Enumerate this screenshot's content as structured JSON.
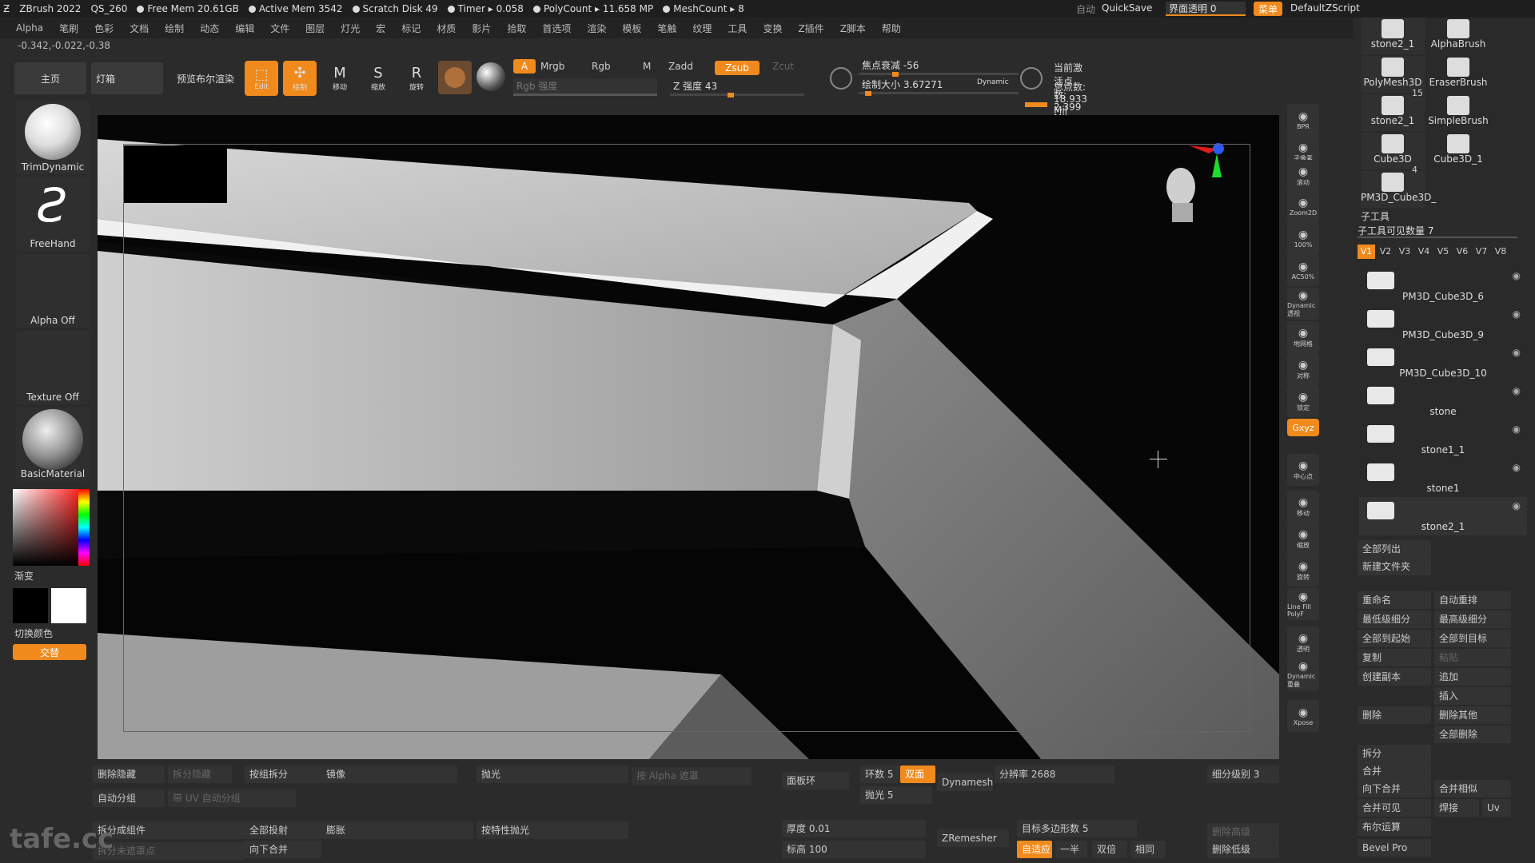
{
  "titlebar": {
    "app": "ZBrush 2022",
    "doc": "QS_260",
    "stats": [
      "Free Mem 20.61GB",
      "Active Mem 3542",
      "Scratch Disk 49",
      "Timer ▸ 0.058",
      "PolyCount ▸ 11.658 MP",
      "MeshCount ▸ 8"
    ],
    "auto": "自动",
    "quicksave": "QuickSave",
    "transparency": "界面透明 0",
    "menu_btn": "菜单",
    "script": "DefaultZScript"
  },
  "menubar": [
    "Alpha",
    "笔刷",
    "色彩",
    "文档",
    "绘制",
    "动态",
    "编辑",
    "文件",
    "图层",
    "灯光",
    "宏",
    "标记",
    "材质",
    "影片",
    "拾取",
    "首选项",
    "渲染",
    "模板",
    "笔触",
    "纹理",
    "工具",
    "变换",
    "Z插件",
    "Z脚本",
    "帮助"
  ],
  "coords": "-0.342,-0.022,-0.38",
  "toolbar": {
    "home": "主页",
    "lightbox": "灯箱",
    "bpr": "预览布尔渲染",
    "edit": "Edit",
    "draw": "绘制",
    "move": "移动",
    "scale": "缩放",
    "rotate": "旋转",
    "a": "A",
    "mrgb": "Mrgb",
    "rgb": "Rgb",
    "m": "M",
    "rgb_intensity": "Rgb 强度",
    "zadd": "Zadd",
    "zsub": "Zsub",
    "zcut": "Zcut",
    "z_intensity": "Z 强度 43",
    "z_intensity_value": 43,
    "focal_shift": "焦点衰减 -56",
    "draw_size": "绘制大小 3.67271",
    "dynamic": "Dynamic",
    "active_points": "当前激活点数: 2.399 Mil",
    "total_points": "总点数: 18.933 Mil"
  },
  "leftpanel": {
    "brush1": "TrimDynamic",
    "brush2": "FreeHand",
    "alpha": "Alpha Off",
    "texture": "Texture Off",
    "material": "BasicMaterial",
    "gradient": "渐变",
    "switch_color": "切换颜色",
    "alternate": "交替"
  },
  "rstrip": [
    "BPR",
    "子像素",
    "滚动",
    "Zoom2D",
    "100%",
    "AC50%",
    "Dynamic 透视",
    "地网格",
    "对称",
    "锁定",
    "Gxyz",
    "中心点",
    "移动",
    "缩放",
    "旋转",
    "Line Fill PolyF",
    "透明",
    "Dynamic 重叠",
    "Xpose"
  ],
  "rpanel": {
    "tools": [
      "stone2_1",
      "AlphaBrush",
      "PolyMesh3D",
      "EraserBrush",
      "stone2_1",
      "SimpleBrush",
      "Cube3D",
      "Cube3D_1",
      "PM3D_Cube3D_"
    ],
    "tool_badge_15": "15",
    "tool_badge_4": "4",
    "subtool_title": "子工具",
    "visible_count": "子工具可见数量 7",
    "versions": [
      "V1",
      "V2",
      "V3",
      "V4",
      "V5",
      "V6",
      "V7",
      "V8"
    ],
    "subtools": [
      "PM3D_Cube3D_6",
      "PM3D_Cube3D_9",
      "PM3D_Cube3D_10",
      "stone",
      "stone1_1",
      "stone1",
      "stone2_1"
    ],
    "list_all": "全部列出",
    "new_folder": "新建文件夹",
    "rename": "重命名",
    "auto_reorder": "自动重排",
    "lowest_sub": "最低级细分",
    "highest_sub": "最高级细分",
    "all_to_start": "全部到起始",
    "all_to_target": "全部到目标",
    "copy": "复制",
    "paste": "粘贴",
    "create_copy": "创建副本",
    "append": "追加",
    "insert": "插入",
    "delete": "删除",
    "delete_other": "删除其他",
    "delete_all": "全部删除",
    "split": "拆分",
    "merge": "合并",
    "merge_down": "向下合并",
    "merge_similar": "合并相似",
    "merge_visible": "合并可见",
    "weld": "焊接",
    "uv": "Uv",
    "boolean": "布尔运算",
    "bevel_pro": "Bevel Pro"
  },
  "bottom": {
    "del_hidden": "删除隐藏",
    "split_hidden": "拆分隐藏",
    "split_groups": "按组拆分",
    "mirror": "镜像",
    "polish": "抛光",
    "alpha_mask": "按 Alpha 遮罩",
    "face_loop": "面板环",
    "loops": "环数 5",
    "double": "双面",
    "dynamesh": "Dynamesh",
    "resolution": "分辨率 2688",
    "sub_level": "细分级别 3",
    "auto_groups": "自动分组",
    "uv_groups": "带 UV 自动分组",
    "polish5": "抛光 5",
    "split_parts": "拆分成组件",
    "project_all": "全部投射",
    "inflate": "膨胀",
    "polish_feat": "按特性抛光",
    "thickness": "厚度 0.01",
    "target_poly": "目标多边形数 5",
    "zremesher": "ZRemesher",
    "del_higher": "删除高级",
    "merge_down": "向下合并",
    "height": "标高 100",
    "adapt": "自适应",
    "half": "一半",
    "same": "相同",
    "doubled": "双倍",
    "del_lower": "删除低级",
    "extract_points": "拆分未遮罩点",
    "watermark": "tafe.cc"
  },
  "colors": {
    "accent": "#f08a1c",
    "bg": "#2b2b2b",
    "panel": "#333333"
  }
}
